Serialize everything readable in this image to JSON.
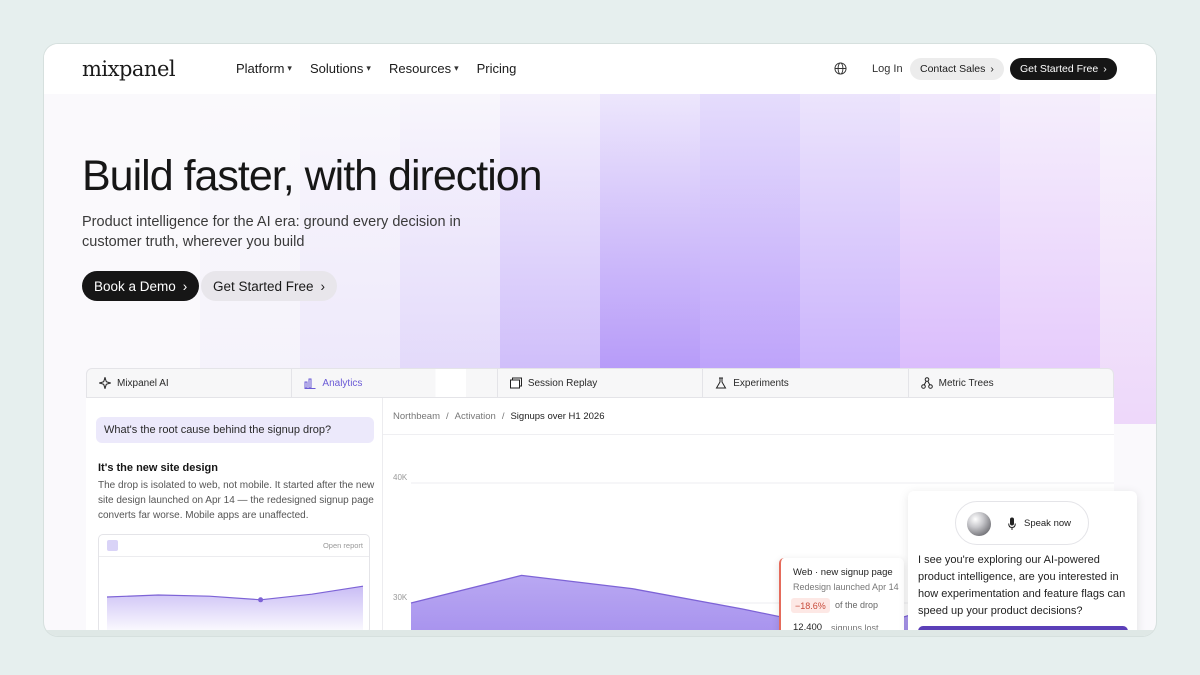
{
  "nav": {
    "logo": "mixpanel",
    "links": [
      {
        "label": "Platform",
        "has_menu": true
      },
      {
        "label": "Solutions",
        "has_menu": true
      },
      {
        "label": "Resources",
        "has_menu": true
      },
      {
        "label": "Pricing",
        "has_menu": false
      }
    ],
    "globe_icon": "globe-icon",
    "login": "Log In",
    "contact_sales": "Contact Sales",
    "get_started": "Get Started Free"
  },
  "hero": {
    "title": "Build faster, with direction",
    "subtitle": "Product intelligence for the AI era: ground every decision in customer truth, wherever you build",
    "primary_cta": "Book a Demo",
    "secondary_cta": "Get Started Free"
  },
  "tabs": [
    {
      "label": "Mixpanel AI",
      "icon": "sparkle-icon",
      "active": false
    },
    {
      "label": "Analytics",
      "icon": "bar-chart-icon",
      "active": true
    },
    {
      "label": "Session Replay",
      "icon": "replay-icon",
      "active": false
    },
    {
      "label": "Experiments",
      "icon": "flask-icon",
      "active": false
    },
    {
      "label": "Metric Trees",
      "icon": "tree-icon",
      "active": false
    }
  ],
  "ai_panel": {
    "question": "What's the root cause behind the signup drop?",
    "answer_title": "It's the new site design",
    "answer_body": "The drop is isolated to web, not mobile. It started after the new site design launched on Apr 14 — the redesigned signup page converts far worse. Mobile apps are unaffected.",
    "mini_card_link": "Open report",
    "mini_series": [
      0.45,
      0.5,
      0.47,
      0.38,
      0.52,
      0.72
    ]
  },
  "analytics": {
    "breadcrumbs": [
      "Northbeam",
      "Activation",
      "Signups over H1 2026"
    ]
  },
  "chart_data": {
    "type": "area",
    "title": "Signups over H1 2026",
    "xlabel": "",
    "ylabel": "",
    "y_ticks": [
      "40K",
      "30K"
    ],
    "y_tick_values": [
      40000,
      30000
    ],
    "ylim": [
      24000,
      44000
    ],
    "grid": true,
    "series": [
      {
        "values": [
          30000,
          32300,
          31200,
          29500,
          27600,
          30300
        ],
        "highlight_index": 4,
        "color": "#7d63d6"
      }
    ]
  },
  "tooltip": {
    "title": "Web · new signup page",
    "subtitle": "Redesign launched Apr 14",
    "change": "−18.6%",
    "change_label": "of the drop",
    "count": "12,400",
    "count_label": "signups lost"
  },
  "assistant": {
    "speak_label": "Speak now",
    "message": "I see you're exploring our AI-powered product intelligence, are you interested in how experimentation and feature flags can speed up your product decisions?"
  },
  "colors": {
    "accent": "#7d63d6",
    "dark": "#161616",
    "negative": "#c84b3b"
  }
}
